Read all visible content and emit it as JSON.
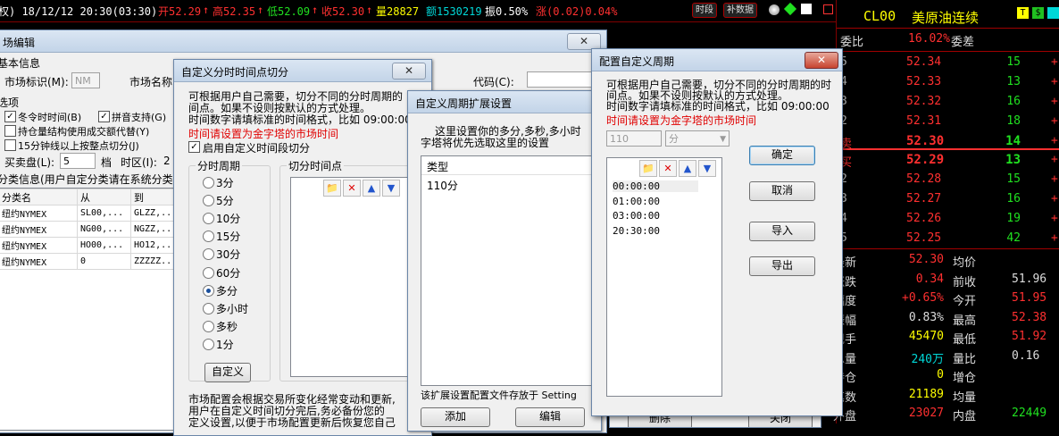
{
  "topbar": {
    "period": "权) 18/12/12 20:30(03:30)",
    "open_label": "开52.29",
    "high_label": "高52.35",
    "low_label": "低52.09",
    "close_label": "收52.30",
    "vol_label": "量28827",
    "amount_label": "额1530219",
    "amp_label": "振0.50%",
    "chg_label": "涨(0.02)0.04%",
    "btn_period": "时段",
    "btn_data": "补数据",
    "up_arrow": "↑",
    "down_arrow": "↓",
    "colors": {
      "up": "#ff3030",
      "down": "#20e020",
      "cyan": "#00d8d8",
      "yellow": "#ffff00"
    }
  },
  "quote": {
    "symbol": "CL00",
    "name": "美原油连续",
    "weibi_label": "委比",
    "weibi_value": "16.02%",
    "weicha_label": "委差",
    "sell": [
      {
        "lvl": "5",
        "price": "52.34",
        "vol": "15"
      },
      {
        "lvl": "4",
        "price": "52.33",
        "vol": "13"
      },
      {
        "lvl": "3",
        "price": "52.32",
        "vol": "16"
      },
      {
        "lvl": "2",
        "price": "52.31",
        "vol": "18"
      },
      {
        "lvl": "卖",
        "price": "52.30",
        "vol": "14"
      }
    ],
    "buy": [
      {
        "lvl": "买",
        "price": "52.29",
        "vol": "13"
      },
      {
        "lvl": "2",
        "price": "52.28",
        "vol": "15"
      },
      {
        "lvl": "3",
        "price": "52.27",
        "vol": "16"
      },
      {
        "lvl": "4",
        "price": "52.26",
        "vol": "19"
      },
      {
        "lvl": "5",
        "price": "52.25",
        "vol": "42"
      }
    ],
    "stats": [
      {
        "l1": "最新",
        "v1": "52.30",
        "l2": "均价",
        "v2": ""
      },
      {
        "l1": "涨跌",
        "v1": "0.34",
        "l2": "前收",
        "v2": "51.96"
      },
      {
        "l1": "幅度",
        "v1": "+0.65%",
        "l2": "今开",
        "v2": "51.95"
      },
      {
        "l1": "振幅",
        "v1": "0.83%",
        "l2": "最高",
        "v2": "52.38"
      },
      {
        "l1": "现手",
        "v1": "45470",
        "l2": "最低",
        "v2": "51.92"
      },
      {
        "l1": "总量",
        "v1": "240万",
        "l2": "量比",
        "v2": "0.16"
      },
      {
        "l1": "持仓",
        "v1": "0",
        "l2": "增仓",
        "v2": ""
      },
      {
        "l1": "笔数",
        "v1": "21189",
        "l2": "均量",
        "v2": ""
      },
      {
        "l1": "外盘",
        "v1": "23027",
        "l2": "内盘",
        "v2": "22449"
      }
    ]
  },
  "mkt": {
    "title": "场编辑",
    "basic_info": "基本信息",
    "market_id_label": "市场标识(M):",
    "market_id_value": "NM",
    "market_name_label": "市场名称",
    "options_label": "选项",
    "opt1": "冬令时时间(B)",
    "opt2": "拼音支持(G)",
    "opt3": "持仓量结构使用成交额代替(Y)",
    "opt4": "15分钟线以上按整点切分(J)",
    "buy_sell_label": "买卖盘(L):",
    "buy_sell_value": "5",
    "dang": "档",
    "zone_label": "时区(I):",
    "zone_value": "2",
    "class_info": "分类信息(用户自定分类请在系统分类",
    "cols": [
      "分类名",
      "从",
      "到"
    ],
    "rows": [
      [
        "纽约NYMEX",
        "SL00,...",
        "GLZZ,..."
      ],
      [
        "纽约NYMEX",
        "NG00,...",
        "NGZZ,..."
      ],
      [
        "纽约NYMEX",
        "HO00,...",
        "HO12,..."
      ],
      [
        "纽约NYMEX",
        "0",
        "ZZZZZ..."
      ]
    ],
    "code_label": "代码(C):",
    "delete_btn": "删除",
    "close_btn": "关闭"
  },
  "split": {
    "title": "自定义分时时间点切分",
    "desc1": "可根据用户自己需要，切分不同的分时周期的",
    "desc2": "间点。如果不设则按默认的方式处理。",
    "desc3": "时间数字请填标准的时间格式，比如 09:00:00",
    "note": "时间请设置为金字塔的市场时间",
    "enable_label": "启用自定义时间段切分",
    "period_group": "分时周期",
    "points_group": "切分时间点",
    "periods": [
      "3分",
      "5分",
      "10分",
      "15分",
      "30分",
      "60分",
      "多分",
      "多小时",
      "多秒",
      "1分"
    ],
    "custom_btn": "自定义",
    "footer1": "市场配置会根据交易所变化经常变动和更新,",
    "footer2": "用户在自定义时间切分完后,务必备份您的",
    "footer3": "定义设置,以便于市场配置更新后恢复您自己"
  },
  "ext": {
    "title": "自定义周期扩展设置",
    "desc1": "这里设置你的多分,多秒,多小时",
    "desc2": "字塔将优先选取这里的设置",
    "col_type": "类型",
    "items": [
      "110分"
    ],
    "footer": "该扩展设置配置文件存放于 Setting",
    "add_btn": "添加",
    "edit_btn": "编辑"
  },
  "cfg": {
    "title": "配置自定义周期",
    "desc1": "可根据用户自己需要，切分不同的分时周期的时",
    "desc2": "间点。如果不设则按默认的方式处理。",
    "desc3": "时间数字请填标准的时间格式，比如 09:00:00",
    "note": "时间请设置为金字塔的市场时间",
    "period_value": "110",
    "unit_value": "分",
    "times": [
      "00:00:00",
      "01:00:00",
      "03:00:00",
      "20:30:00"
    ],
    "ok_btn": "确定",
    "cancel_btn": "取消",
    "import_btn": "导入",
    "export_btn": "导出"
  }
}
